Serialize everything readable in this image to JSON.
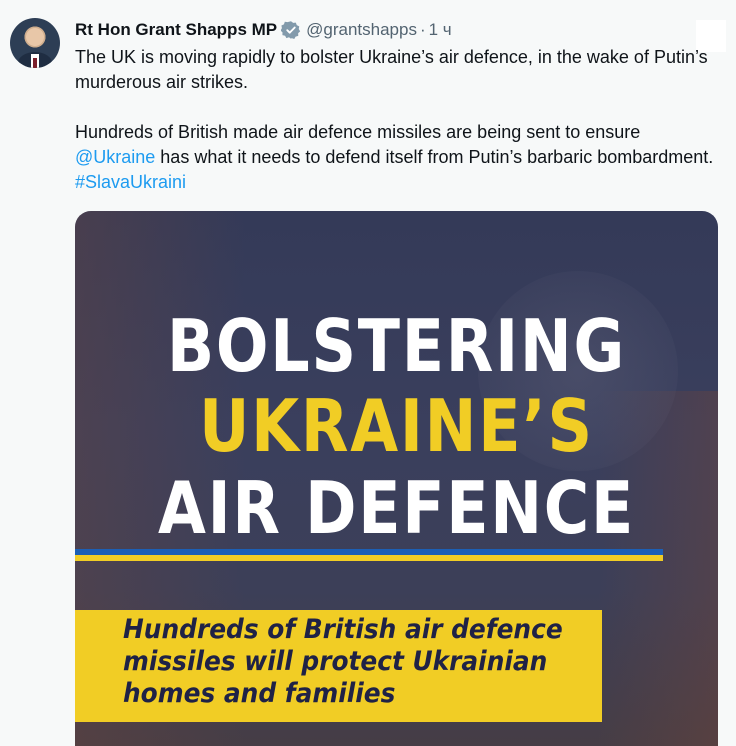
{
  "tweet": {
    "author_name": "Rt Hon Grant Shapps MP",
    "handle": "@grantshapps",
    "separator": "·",
    "time": "1 ч",
    "paragraph1": "The UK is moving rapidly to bolster Ukraine’s air defence, in the wake of Putin’s murderous air strikes.",
    "paragraph2_before": "Hundreds of British made air defence missiles are being sent to ensure ",
    "mention": "@Ukraine",
    "paragraph2_after": " has what it needs to defend itself from Putin’s barbaric bombardment. ",
    "hashtag": "#SlavaUkraini"
  },
  "media": {
    "headline_line1": "BOLSTERING",
    "headline_line2": "UKRAINE’S",
    "headline_line3": "AIR DEFENCE",
    "callout": "Hundreds of British air defence\nmissiles will protect Ukrainian\nhomes and families"
  },
  "icons": {
    "verified": "verified-badge-icon",
    "avatar": "profile-avatar"
  },
  "colors": {
    "link": "#1d9bf0",
    "verified": "#829aab",
    "headline_yellow": "#f1cd25",
    "flag_blue": "#1c5fb5",
    "background": "#f7f9f9"
  }
}
